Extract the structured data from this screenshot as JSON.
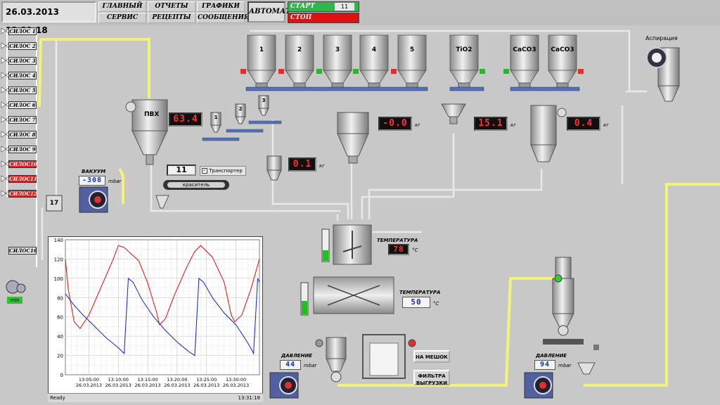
{
  "datetime": "26.03.2013 13:31:18",
  "nav": {
    "main": "ГЛАВНЫЙ",
    "reports": "ОТЧЕТЫ",
    "graphs": "ГРАФИКИ",
    "service": "СЕРВИС",
    "recipes": "РЕЦЕПТЫ",
    "messages": "СООБЩЕНИЯ",
    "auto": "АВТОМАТ",
    "start": "СТАРТ",
    "start_count": "11",
    "stop": "СТОП"
  },
  "silos": [
    {
      "label": "СИЛОС 1",
      "alarm": false
    },
    {
      "label": "СИЛОС 2",
      "alarm": false
    },
    {
      "label": "СИЛОС 3",
      "alarm": false
    },
    {
      "label": "СИЛОС 4",
      "alarm": false
    },
    {
      "label": "СИЛОС 5",
      "alarm": false
    },
    {
      "label": "СИЛОС 6",
      "alarm": false
    },
    {
      "label": "СИЛОС 7",
      "alarm": false
    },
    {
      "label": "СИЛОС 8",
      "alarm": false
    },
    {
      "label": "СИЛОС 9",
      "alarm": false
    },
    {
      "label": "СИЛОС10",
      "alarm": true
    },
    {
      "label": "СИЛОС11",
      "alarm": true
    },
    {
      "label": "СИЛОС12",
      "alarm": true
    }
  ],
  "silo16": "СИЛОС16",
  "bunkers": [
    "1",
    "2",
    "3",
    "4",
    "5",
    "TiO2",
    "CaCO3",
    "CaCO3"
  ],
  "small_hoppers": [
    "1",
    "2",
    "3"
  ],
  "pvh": {
    "label": "ПВХ",
    "value": "63.4"
  },
  "main_scale": {
    "value": "-0.0",
    "unit": "кг"
  },
  "tio2_scale": {
    "value": "15.1",
    "unit": "кг"
  },
  "caco3_scale": {
    "value": "0.4",
    "unit": "кг"
  },
  "dye_scale": {
    "value": "0.1",
    "unit": "кг"
  },
  "vacuum": {
    "label": "ВАКУУМ",
    "value": "-308",
    "unit": "mbar"
  },
  "conveyor": {
    "count": "11",
    "label": "Транспортер",
    "belt": "краситель"
  },
  "container17": "17",
  "min_label": "min",
  "aspiration": "Аспирация",
  "mixer_temp": {
    "label": "ТЕМПЕРАТУРА",
    "value": "78",
    "unit": "°C"
  },
  "cooler_temp": {
    "label": "ТЕМПЕРАТУРА",
    "value": "50",
    "unit": "°C"
  },
  "pressure1": {
    "label": "ДАВЛЕНИЕ",
    "value": "44",
    "unit": "mbar"
  },
  "pressure2": {
    "label": "ДАВЛЕНИЕ",
    "value": "94",
    "unit": "mbar"
  },
  "btn_bag": "НА МЕШОК",
  "btn_filter_line1": "ФИЛЬТРА",
  "btn_filter_line2": "ВЫГРУЗКИ",
  "status": {
    "ready": "Ready",
    "time": "13:31:18"
  },
  "colors": {
    "red_series": "#e02020",
    "blue_series": "#2030d0",
    "pipe_yellow": "#f0f080"
  },
  "chart_data": {
    "type": "line",
    "ylim": [
      0,
      140
    ],
    "yticks": [
      0,
      20,
      40,
      60,
      80,
      100,
      120,
      140
    ],
    "xticks": [
      {
        "time": "13:05:00",
        "date": "26.03.2013"
      },
      {
        "time": "13:10:00",
        "date": "26.03.2013"
      },
      {
        "time": "13:15:00",
        "date": "26.03.2013"
      },
      {
        "time": "13:20:00",
        "date": "26.03.2013"
      },
      {
        "time": "13:25:00",
        "date": "26.03.2013"
      },
      {
        "time": "13:30:00",
        "date": "26.03.2013"
      }
    ],
    "x_minutes_range": [
      0,
      33
    ],
    "grid": true,
    "series": [
      {
        "color": "#e02020",
        "points": [
          [
            0,
            120
          ],
          [
            0.5,
            88
          ],
          [
            1.5,
            55
          ],
          [
            2.5,
            48
          ],
          [
            4,
            62
          ],
          [
            6,
            90
          ],
          [
            8,
            118
          ],
          [
            9,
            134
          ],
          [
            10,
            132
          ],
          [
            12.5,
            118
          ],
          [
            14,
            95
          ],
          [
            15.5,
            65
          ],
          [
            16,
            52
          ],
          [
            17,
            58
          ],
          [
            18.5,
            82
          ],
          [
            20.5,
            110
          ],
          [
            22,
            128
          ],
          [
            23,
            134
          ],
          [
            25,
            122
          ],
          [
            27,
            96
          ],
          [
            28.2,
            62
          ],
          [
            28.8,
            55
          ],
          [
            30,
            62
          ],
          [
            31.5,
            88
          ],
          [
            33,
            120
          ]
        ]
      },
      {
        "color": "#2030d0",
        "points": [
          [
            0,
            84
          ],
          [
            1.5,
            72
          ],
          [
            3,
            62
          ],
          [
            5,
            50
          ],
          [
            7,
            38
          ],
          [
            9,
            28
          ],
          [
            10,
            22
          ],
          [
            10.7,
            100
          ],
          [
            11.5,
            96
          ],
          [
            13,
            78
          ],
          [
            15,
            60
          ],
          [
            17,
            46
          ],
          [
            19,
            34
          ],
          [
            21,
            24
          ],
          [
            22,
            20
          ],
          [
            22.7,
            100
          ],
          [
            23.5,
            96
          ],
          [
            25,
            80
          ],
          [
            27,
            64
          ],
          [
            29,
            52
          ],
          [
            30.5,
            38
          ],
          [
            31.5,
            28
          ],
          [
            32,
            22
          ],
          [
            32.7,
            100
          ],
          [
            33,
            96
          ]
        ]
      }
    ]
  }
}
